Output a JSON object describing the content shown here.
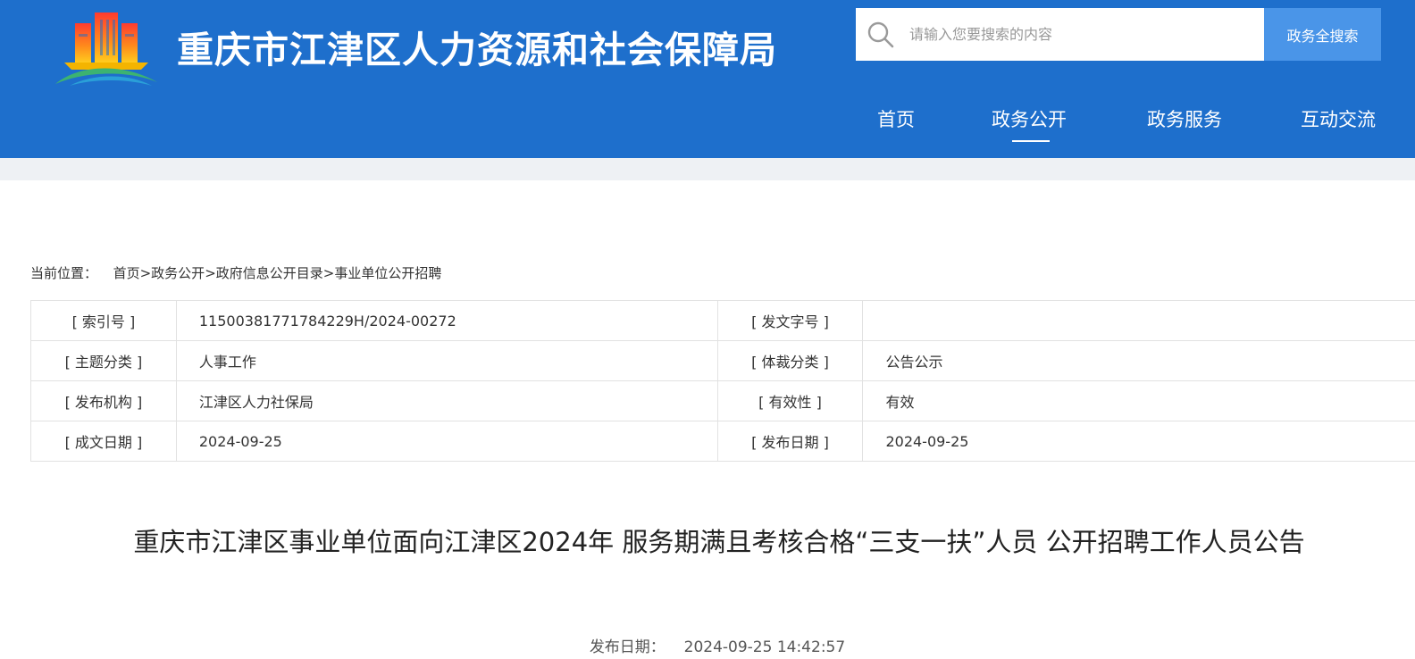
{
  "header": {
    "site_title": "重庆市江津区人力资源和社会保障局",
    "logo_icon": "emblem-logo-icon",
    "colors": {
      "header_bg": "#1e6fcc",
      "search_button_bg": "#4a95e8"
    }
  },
  "search": {
    "placeholder": "请输入您要搜索的内容",
    "value": "",
    "button_label": "政务全搜索",
    "icon": "search-icon"
  },
  "nav": {
    "items": [
      {
        "label": "首页"
      },
      {
        "label": "政务公开",
        "active": true
      },
      {
        "label": "政务服务"
      },
      {
        "label": "互动交流"
      }
    ]
  },
  "breadcrumb": {
    "prefix": "当前位置：",
    "items": [
      "首页",
      "政务公开",
      "政府信息公开目录",
      "事业单位公开招聘"
    ],
    "separator": ">"
  },
  "info": {
    "rows": [
      {
        "label1": "[ 索引号 ]",
        "value1": "11500381771784229H/2024-00272",
        "label2": "[ 发文字号 ]",
        "value2": ""
      },
      {
        "label1": "[ 主题分类 ]",
        "value1": "人事工作",
        "label2": "[ 体裁分类 ]",
        "value2": "公告公示"
      },
      {
        "label1": "[ 发布机构 ]",
        "value1": "江津区人力社保局",
        "label2": "[ 有效性 ]",
        "value2": "有效"
      },
      {
        "label1": "[ 成文日期 ]",
        "value1": "2024-09-25",
        "label2": "[ 发布日期 ]",
        "value2": "2024-09-25"
      }
    ]
  },
  "article": {
    "title": "重庆市江津区事业单位面向江津区2024年 服务期满且考核合格“三支一扶”人员 公开招聘工作人员公告",
    "publish_label": "发布日期：",
    "publish_datetime": "2024-09-25 14:42:57"
  }
}
